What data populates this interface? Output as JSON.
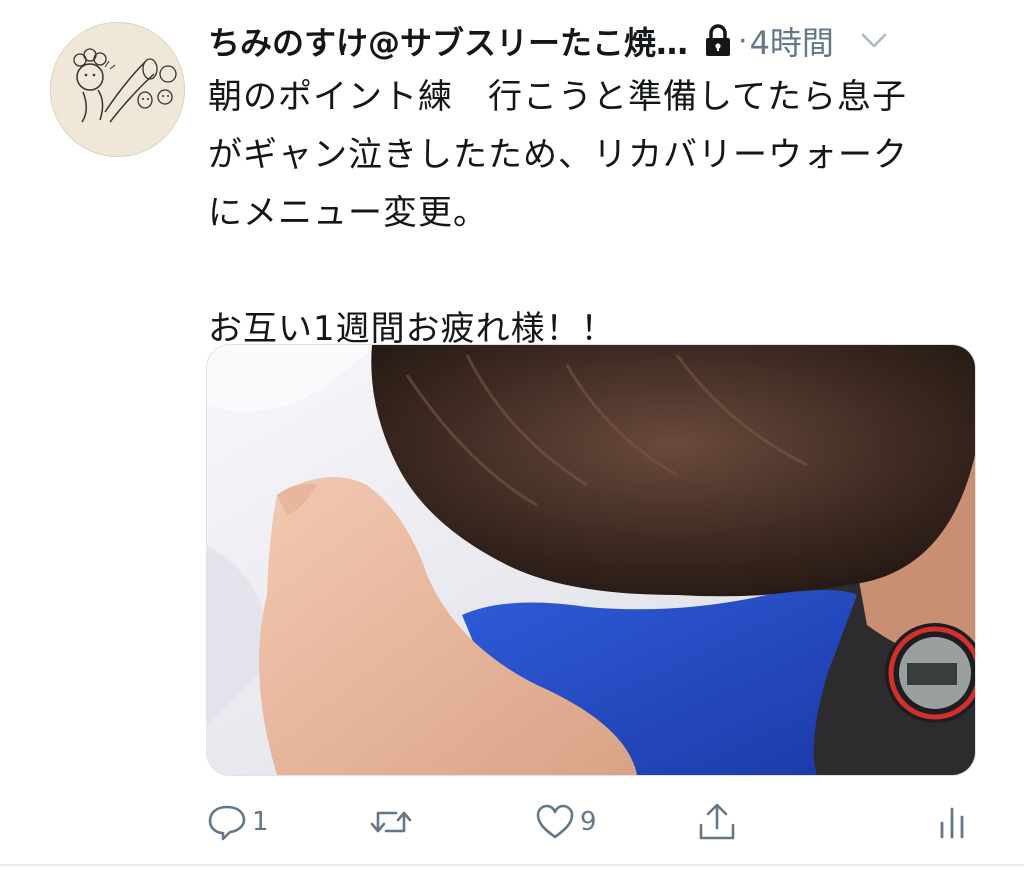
{
  "tweet": {
    "display_name": "ちみのすけ@サブスリーたこ焼…",
    "separator": "·",
    "time": "4時間",
    "text": "朝のポイント練　行こうと準備してたら息子\nがギャン泣きしたため、リカバリーウォーク\nにメニュー変更。\n\nお互い1週間お疲れ様！！",
    "icons": {
      "lock": "lock-icon",
      "menu": "chevron-down-icon",
      "reply": "reply-icon",
      "retweet": "retweet-icon",
      "like": "heart-icon",
      "share": "share-icon",
      "analytics": "analytics-icon"
    }
  },
  "actions": {
    "reply_count": "1",
    "like_count": "9"
  },
  "colors": {
    "text": "#14171a",
    "secondary": "#657786",
    "divider": "#e6ecf0"
  }
}
